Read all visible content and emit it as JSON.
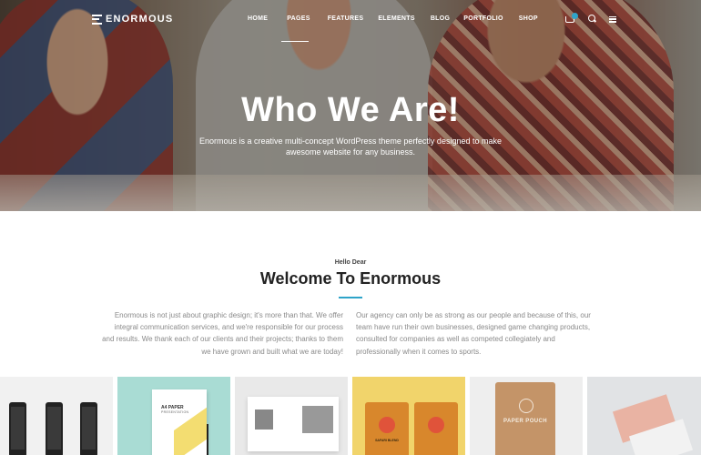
{
  "brand": {
    "name": "ENORMOUS"
  },
  "nav": {
    "items": [
      "HOME",
      "PAGES",
      "FEATURES",
      "ELEMENTS",
      "BLOG",
      "PORTFOLIO",
      "SHOP"
    ],
    "active": "PAGES",
    "icons": [
      "cart-icon",
      "search-icon",
      "menu-icon"
    ],
    "accent": "#2ea4c9"
  },
  "hero": {
    "title": "Who We Are!",
    "subtitle": "Enormous is a creative multi-concept WordPress theme perfectly designed to make awesome website for any business."
  },
  "welcome": {
    "eyebrow": "Hello Dear",
    "title": "Welcome To Enormous",
    "left_text": "Enormous is not just about graphic design; it's more than that. We offer integral communication services, and we're responsible for our process and results. We thank each of our clients and their projects; thanks to them we have grown and built what we are today!",
    "right_text": "Our agency can only be as strong as our people and because of this, our team have run their own businesses, designed game changing products, consulted for companies as well as competed collegiately and professionally when it comes to sports."
  },
  "portfolio": {
    "paper_title": "A4 PAPER",
    "paper_sub": "PRESENTATION",
    "bag_text": "SAFARI BLEND",
    "pouch_text": "PAPER POUCH"
  }
}
